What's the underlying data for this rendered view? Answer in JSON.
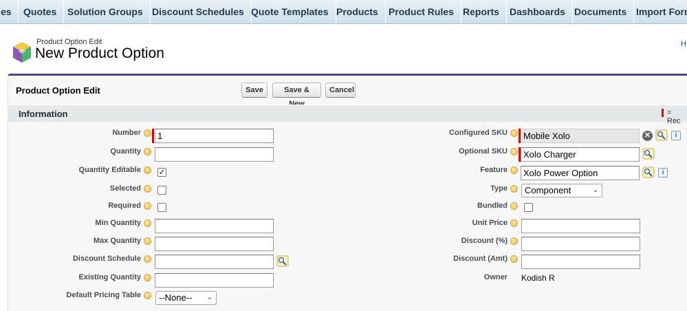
{
  "tabs": [
    "es",
    "Quotes",
    "Solution Groups",
    "Discount Schedules",
    "Quote Templates",
    "Products",
    "Product Rules",
    "Reports",
    "Dashboards",
    "Documents",
    "Import Form"
  ],
  "header": {
    "type_label": "Product Option Edit",
    "title": "New Product Option",
    "help_link": "H"
  },
  "block": {
    "title": "Product Option Edit",
    "buttons": {
      "save": "Save",
      "save_new": "Save & New",
      "cancel": "Cancel"
    }
  },
  "section": {
    "title": "Information",
    "required_legend": "= Rec"
  },
  "left_fields": {
    "number": {
      "label": "Number",
      "value": "1"
    },
    "quantity": {
      "label": "Quantity",
      "value": ""
    },
    "quantity_editable": {
      "label": "Quantity Editable",
      "checked": "✓"
    },
    "selected": {
      "label": "Selected",
      "checked": ""
    },
    "required": {
      "label": "Required",
      "checked": ""
    },
    "min_quantity": {
      "label": "Min Quantity",
      "value": ""
    },
    "max_quantity": {
      "label": "Max Quantity",
      "value": ""
    },
    "discount_schedule": {
      "label": "Discount Schedule",
      "value": ""
    },
    "existing_quantity": {
      "label": "Existing Quantity",
      "value": ""
    },
    "default_pricing_table": {
      "label": "Default Pricing Table",
      "value": "--None--"
    }
  },
  "right_fields": {
    "configured_sku": {
      "label": "Configured SKU",
      "value": "Mobile Xolo"
    },
    "optional_sku": {
      "label": "Optional SKU",
      "value": "Xolo Charger"
    },
    "feature": {
      "label": "Feature",
      "value": "Xolo Power Option"
    },
    "type": {
      "label": "Type",
      "value": "Component"
    },
    "bundled": {
      "label": "Bundled",
      "checked": ""
    },
    "unit_price": {
      "label": "Unit Price",
      "value": ""
    },
    "discount_pct": {
      "label": "Discount (%)",
      "value": ""
    },
    "discount_amt": {
      "label": "Discount (Amt)",
      "value": ""
    },
    "owner": {
      "label": "Owner",
      "value": "Kodish R"
    }
  },
  "icons": {
    "lookup": "magnifier-lookup-icon",
    "info": "i",
    "clear": "✕",
    "chevron": "⌵"
  },
  "colors": {
    "accent": "#56458c",
    "required": "#cc0000",
    "tabbar": "#cfdfe9"
  }
}
